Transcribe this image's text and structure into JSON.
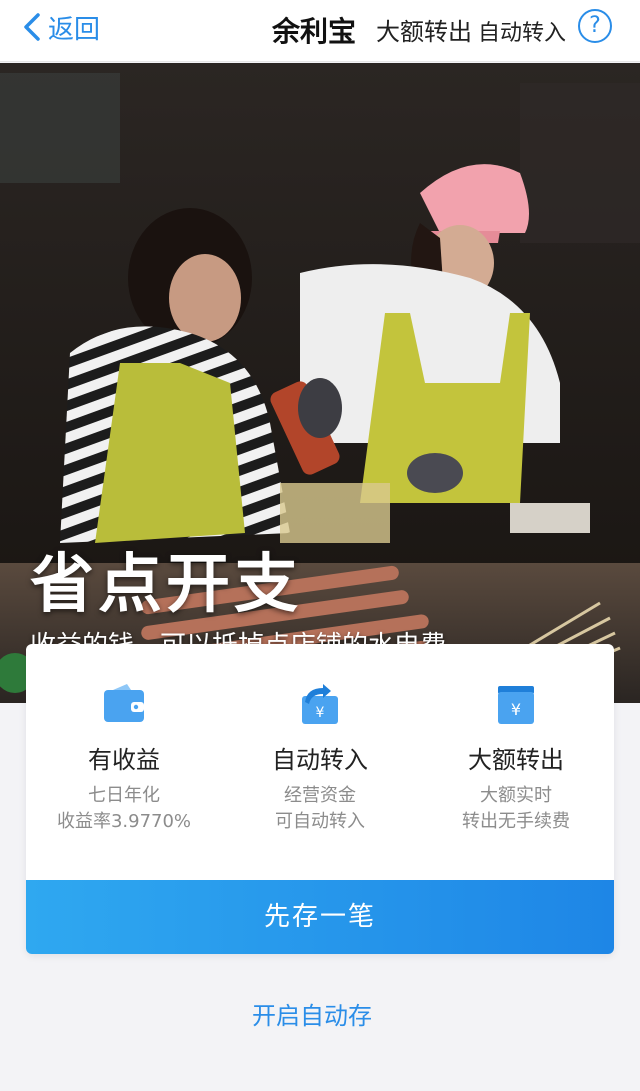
{
  "nav": {
    "back_label": "返回",
    "title": "余利宝",
    "ticker_main": "大额转出",
    "ticker_secondary": "自动转入",
    "help_symbol": "?"
  },
  "hero": {
    "title": "省点开支",
    "subtitle": "收益的钱，可以抵掉点店铺的水电费"
  },
  "features": [
    {
      "icon": "wallet-icon",
      "title": "有收益",
      "line1": "七日年化",
      "line2": "收益率3.9770%"
    },
    {
      "icon": "auto-transfer-icon",
      "title": "自动转入",
      "line1": "经营资金",
      "line2": "可自动转入"
    },
    {
      "icon": "yen-folder-icon",
      "title": "大额转出",
      "line1": "大额实时",
      "line2": "转出无手续费"
    }
  ],
  "actions": {
    "deposit_label": "先存一笔",
    "auto_save_label": "开启自动存"
  },
  "colors": {
    "accent": "#2a8de8",
    "button_start": "#2fa8f0",
    "button_end": "#1e86e6",
    "icon_blue": "#4aa3f0"
  }
}
